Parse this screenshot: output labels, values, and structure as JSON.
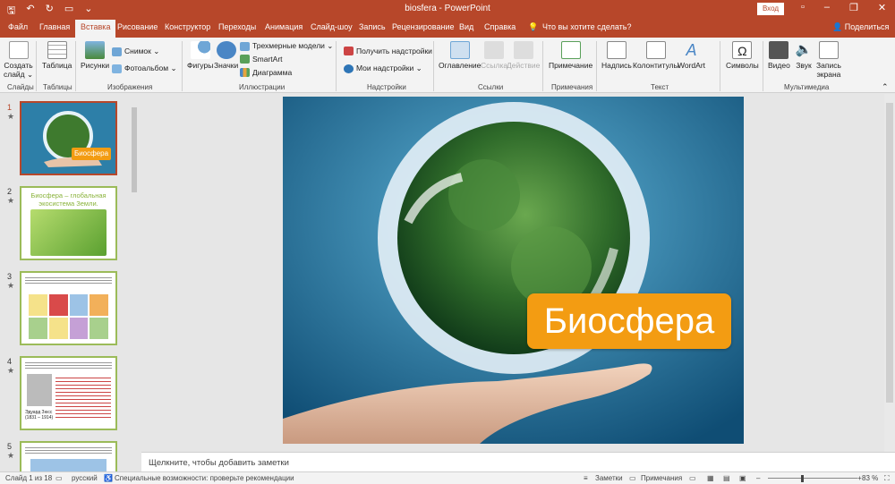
{
  "window": {
    "title": "biosfera  -  PowerPoint",
    "signin_label": "Вход",
    "colors": {
      "accent": "#b7472a",
      "thumb_border": "#9bbb59",
      "slide_badge": "#f39c12"
    }
  },
  "tabs": [
    {
      "label": "Файл"
    },
    {
      "label": "Главная"
    },
    {
      "label": "Вставка"
    },
    {
      "label": "Рисование"
    },
    {
      "label": "Конструктор"
    },
    {
      "label": "Переходы"
    },
    {
      "label": "Анимация"
    },
    {
      "label": "Слайд-шоу"
    },
    {
      "label": "Запись"
    },
    {
      "label": "Рецензирование"
    },
    {
      "label": "Вид"
    },
    {
      "label": "Справка"
    }
  ],
  "tell_me": "Что вы хотите сделать?",
  "share_label": "Поделиться",
  "ribbon": {
    "groups": {
      "slides": "Слайды",
      "tables": "Таблицы",
      "images": "Изображения",
      "illustrations": "Иллюстрации",
      "addins": "Надстройки",
      "links": "Ссылки",
      "comments": "Примечания",
      "text": "Текст",
      "symbols": "",
      "media": "Мультимедиа"
    },
    "buttons": {
      "new_slide_1": "Создать",
      "new_slide_2": "слайд ⌄",
      "table": "Таблица",
      "pictures": "Рисунки",
      "screenshot": "Снимок ⌄",
      "photo_album": "Фотоальбом ⌄",
      "shapes": "Фигуры",
      "icons": "Значки",
      "models_3d": "Трехмерные модели ⌄",
      "smartart": "SmartArt",
      "chart": "Диаграмма",
      "get_addins": "Получить надстройки",
      "my_addins": "Мои надстройки ⌄",
      "zoom": "Оглавление",
      "link": "Ссылка",
      "action": "Действие",
      "comment": "Примечание",
      "textbox": "Надпись",
      "header_footer": "Колонтитулы",
      "wordart": "WordArt",
      "symbols": "Символы",
      "video": "Видео",
      "audio": "Звук",
      "screen_rec_1": "Запись",
      "screen_rec_2": "экрана"
    }
  },
  "thumbnails": [
    {
      "num": "1",
      "star": "★",
      "badge": "Биосфера"
    },
    {
      "num": "2",
      "star": "★",
      "title": "Биосфера – глобальная экосистема Земли."
    },
    {
      "num": "3",
      "star": "★"
    },
    {
      "num": "4",
      "star": "★",
      "caption": "Эдуард Зюсс (1831 – 1914)"
    },
    {
      "num": "5",
      "star": "★"
    }
  ],
  "slide": {
    "title": "Биосфера"
  },
  "notes_placeholder": "Щелкните, чтобы добавить заметки",
  "status": {
    "slide_info": "Слайд 1 из 18",
    "language": "русский",
    "accessibility": "Специальные возможности: проверьте рекомендации",
    "notes": "Заметки",
    "comments": "Примечания",
    "zoom": "83 %"
  }
}
